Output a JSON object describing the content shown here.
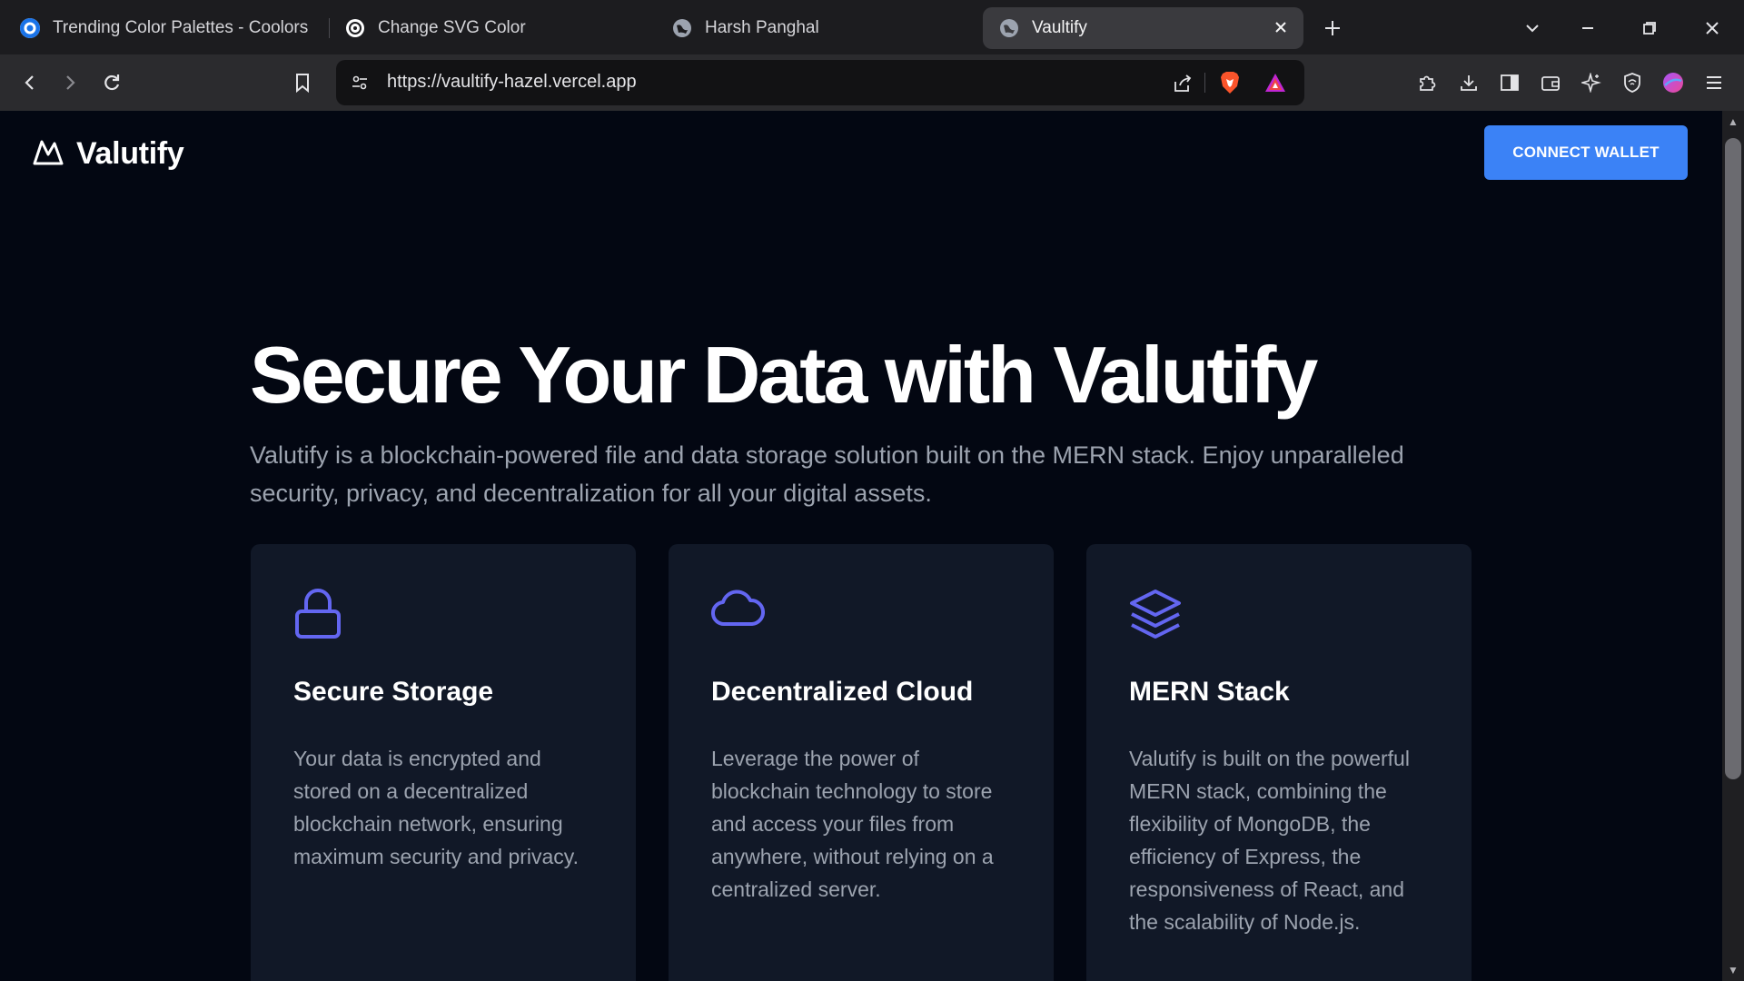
{
  "browser": {
    "tabs": [
      {
        "title": "Trending Color Palettes - Coolors"
      },
      {
        "title": "Change SVG Color"
      },
      {
        "title": "Harsh Panghal"
      },
      {
        "title": "Vaultify"
      }
    ],
    "url": "https://vaultify-hazel.vercel.app"
  },
  "nav": {
    "brand": "Valutify",
    "connect_label": "CONNECT WALLET"
  },
  "hero": {
    "title": "Secure Your Data with Valutify",
    "subtitle": "Valutify is a blockchain-powered file and data storage solution built on the MERN stack. Enjoy unparalleled security, privacy, and decentralization for all your digital assets."
  },
  "features": [
    {
      "icon": "lock-icon",
      "title": "Secure Storage",
      "body": "Your data is encrypted and stored on a decentralized blockchain network, ensuring maximum security and privacy."
    },
    {
      "icon": "cloud-icon",
      "title": "Decentralized Cloud",
      "body": "Leverage the power of blockchain technology to store and access your files from anywhere, without relying on a centralized server."
    },
    {
      "icon": "layers-icon",
      "title": "MERN Stack",
      "body": "Valutify is built on the powerful MERN stack, combining the flexibility of MongoDB, the efficiency of Express, the responsiveness of React, and the scalability of Node.js."
    }
  ],
  "colors": {
    "accent": "#3b82f6",
    "icon": "#6366f1",
    "card_bg": "#111827",
    "page_bg": "#030712"
  }
}
